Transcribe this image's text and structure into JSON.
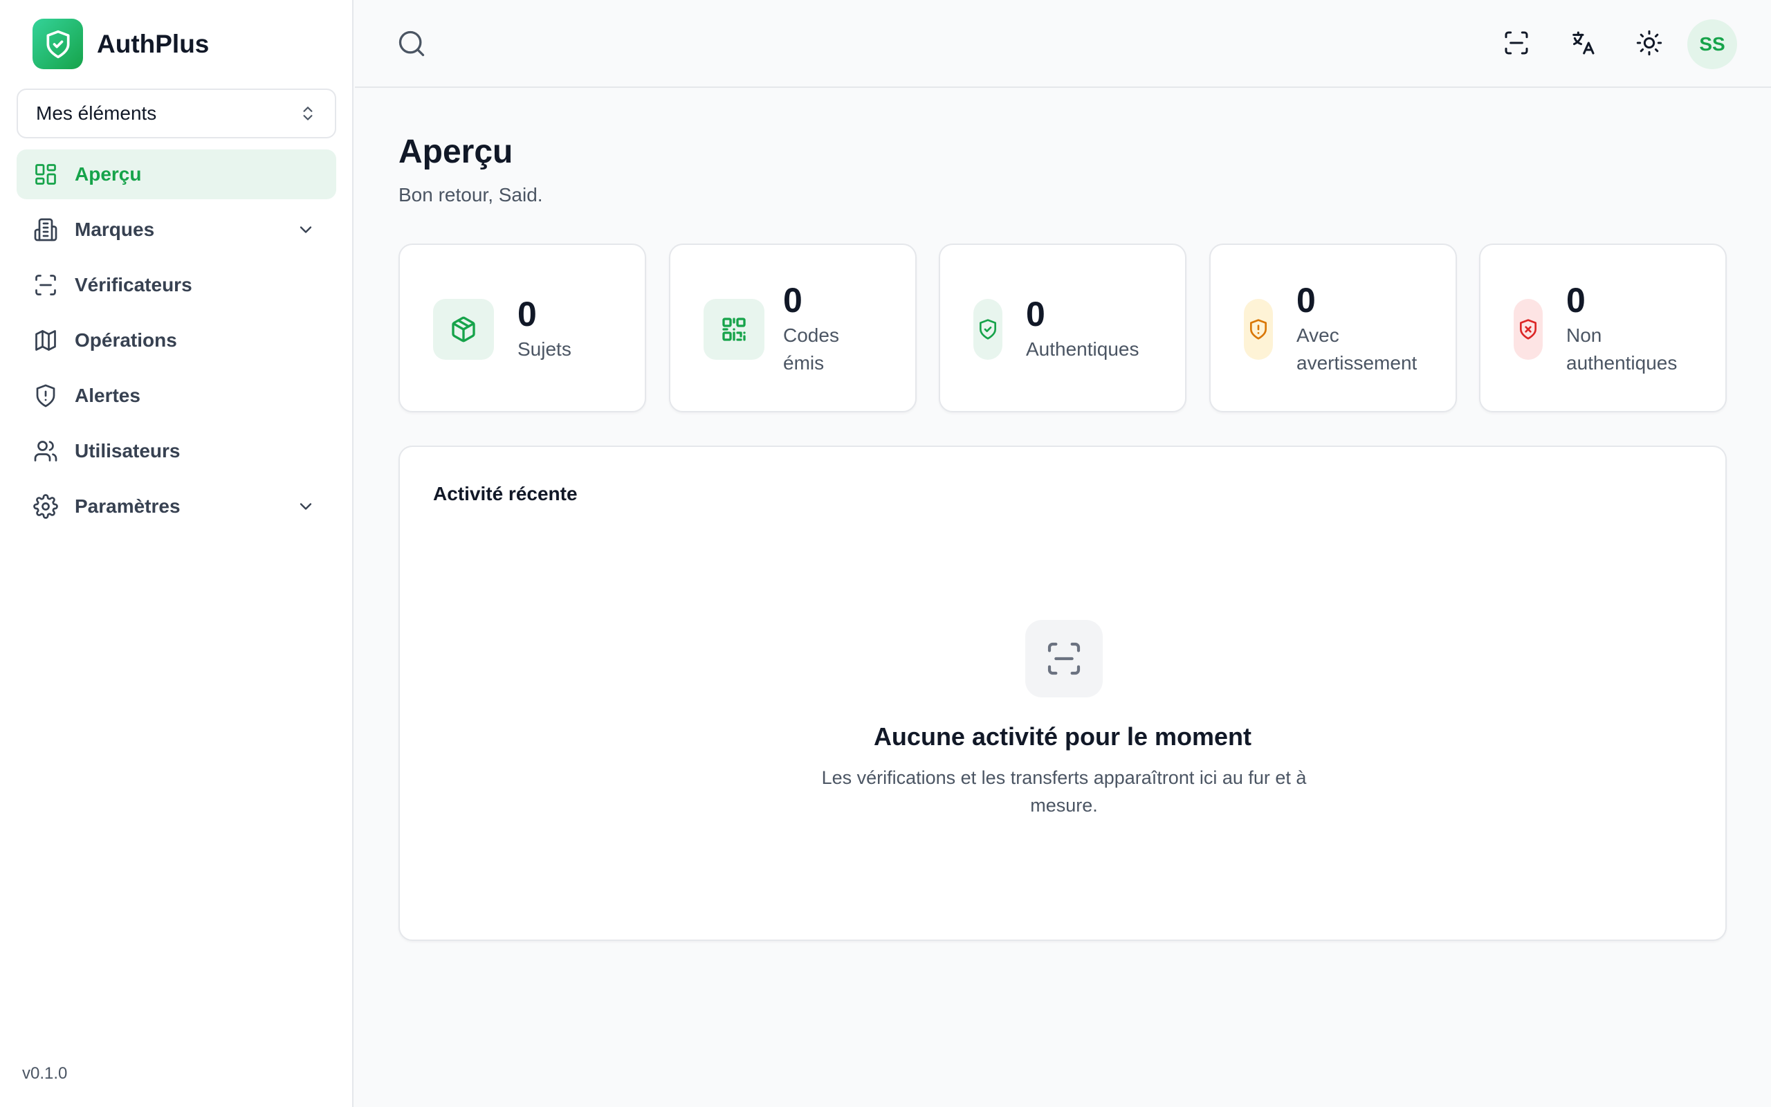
{
  "brand": {
    "name": "AuthPlus"
  },
  "workspace": {
    "label": "Mes éléments"
  },
  "sidebar": {
    "items": [
      {
        "label": "Aperçu",
        "icon": "dashboard-icon",
        "active": true
      },
      {
        "label": "Marques",
        "icon": "building-icon",
        "expandable": true
      },
      {
        "label": "Vérificateurs",
        "icon": "scan-icon"
      },
      {
        "label": "Opérations",
        "icon": "map-icon"
      },
      {
        "label": "Alertes",
        "icon": "shield-alert-icon"
      },
      {
        "label": "Utilisateurs",
        "icon": "users-icon"
      },
      {
        "label": "Paramètres",
        "icon": "gear-icon",
        "expandable": true
      }
    ],
    "version": "v0.1.0"
  },
  "header": {
    "avatar_initials": "SS",
    "actions": [
      "scan-icon",
      "translate-icon",
      "sun-icon"
    ]
  },
  "page": {
    "title": "Aperçu",
    "subtitle": "Bon retour, Said."
  },
  "stats": [
    {
      "value": "0",
      "label_lines": [
        "Sujets"
      ],
      "icon": "package-icon",
      "color": "#16a34a",
      "bg": "#e8f5ee"
    },
    {
      "value": "0",
      "label_lines": [
        "Codes",
        "émis"
      ],
      "icon": "qr-code-icon",
      "color": "#16a34a",
      "bg": "#e8f5ee"
    },
    {
      "value": "0",
      "label_lines": [
        "Authentiques"
      ],
      "icon": "shield-check-icon",
      "color": "#16a34a",
      "bg": "#e8f5ee"
    },
    {
      "value": "0",
      "label_lines": [
        "Avec",
        "avertissement"
      ],
      "icon": "shield-alert-icon",
      "color": "#d97706",
      "bg": "#fef3d6"
    },
    {
      "value": "0",
      "label_lines": [
        "Non",
        "authentiques"
      ],
      "icon": "shield-x-icon",
      "color": "#dc2626",
      "bg": "#fde4e4"
    }
  ],
  "activity": {
    "title": "Activité récente",
    "empty_title": "Aucune activité pour le moment",
    "empty_desc": "Les vérifications et les transferts apparaîtront ici au fur et à mesure."
  }
}
